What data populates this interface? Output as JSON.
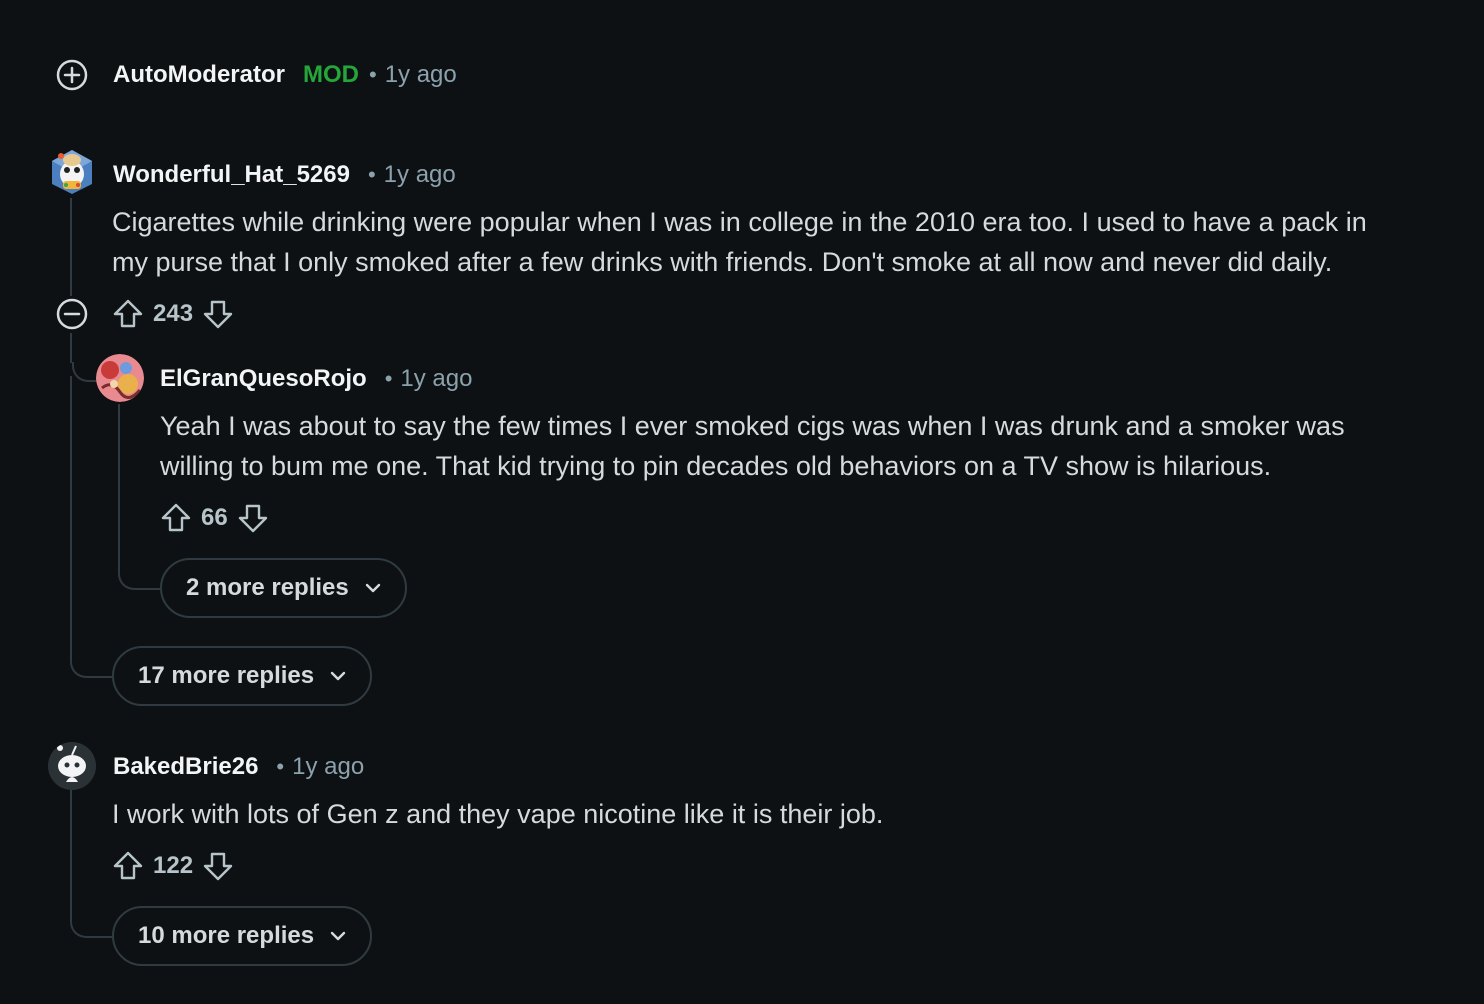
{
  "comments": [
    {
      "username": "AutoModerator",
      "flair": "MOD",
      "separator": "•",
      "time": "1y ago"
    },
    {
      "username": "Wonderful_Hat_5269",
      "separator": "•",
      "time": "1y ago",
      "body_line1": "Cigarettes while drinking were popular when I was in college in the 2010 era too. I used to have a pack in",
      "body_line2": "my purse that I only smoked after a few drinks with friends. Don't smoke at all now and never did daily.",
      "score": "243",
      "more_replies": "17 more replies",
      "reply": {
        "username": "ElGranQuesoRojo",
        "separator": "•",
        "time": "1y ago",
        "body_line1": "Yeah I was about to say the few times I ever smoked cigs was when I was drunk and a smoker was",
        "body_line2": "willing to bum me one. That kid trying to pin decades old behaviors on a TV show is hilarious.",
        "score": "66",
        "more_replies": "2 more replies"
      }
    },
    {
      "username": "BakedBrie26",
      "separator": "•",
      "time": "1y ago",
      "body_line1": "I work with lots of Gen z and they vape nicotine like it is their job.",
      "score": "122",
      "more_replies": "10 more replies"
    }
  ],
  "colors": {
    "background": "#0e1113",
    "mod_green": "#25a63a",
    "thread_line": "#2f3b40"
  },
  "icons": [
    "expand-plus-icon",
    "collapse-minus-icon",
    "upvote-arrow-icon",
    "downvote-arrow-icon",
    "chevron-down-icon"
  ]
}
